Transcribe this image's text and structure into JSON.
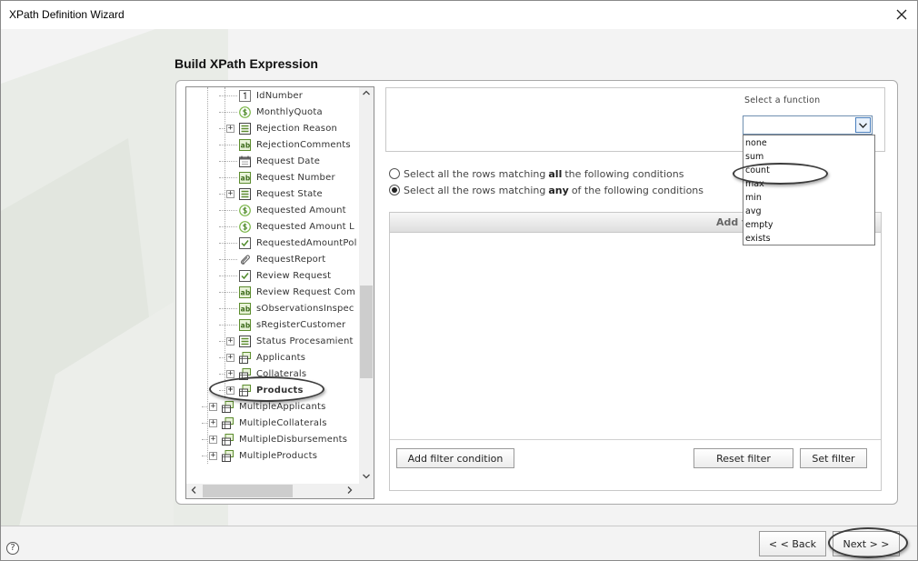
{
  "window": {
    "title": "XPath Definition Wizard"
  },
  "heading": "Build XPath Expression",
  "tree": {
    "items": [
      {
        "label": "IdNumber",
        "icon": "number-field-icon",
        "expander": false,
        "level": 2,
        "bold": false
      },
      {
        "label": "MonthlyQuota",
        "icon": "currency-field-icon",
        "expander": false,
        "level": 2,
        "bold": false
      },
      {
        "label": "Rejection Reason",
        "icon": "list-field-icon",
        "expander": true,
        "level": 2,
        "bold": false
      },
      {
        "label": "RejectionComments",
        "icon": "text-field-icon",
        "expander": false,
        "level": 2,
        "bold": false
      },
      {
        "label": "Request Date",
        "icon": "date-field-icon",
        "expander": false,
        "level": 2,
        "bold": false
      },
      {
        "label": "Request Number",
        "icon": "text-field-icon",
        "expander": false,
        "level": 2,
        "bold": false
      },
      {
        "label": "Request State",
        "icon": "list-field-icon",
        "expander": true,
        "level": 2,
        "bold": false
      },
      {
        "label": "Requested Amount",
        "icon": "currency-field-icon",
        "expander": false,
        "level": 2,
        "bold": false
      },
      {
        "label": "Requested Amount L",
        "icon": "currency-field-icon",
        "expander": false,
        "level": 2,
        "bold": false
      },
      {
        "label": "RequestedAmountPol",
        "icon": "boolean-field-icon",
        "expander": false,
        "level": 2,
        "bold": false
      },
      {
        "label": "RequestReport",
        "icon": "attachment-icon",
        "expander": false,
        "level": 2,
        "bold": false
      },
      {
        "label": "Review Request",
        "icon": "boolean-field-icon",
        "expander": false,
        "level": 2,
        "bold": false
      },
      {
        "label": "Review Request Com",
        "icon": "text-field-icon",
        "expander": false,
        "level": 2,
        "bold": false
      },
      {
        "label": "sObservationsInspec",
        "icon": "text-field-icon",
        "expander": false,
        "level": 2,
        "bold": false
      },
      {
        "label": "sRegisterCustomer",
        "icon": "text-field-icon",
        "expander": false,
        "level": 2,
        "bold": false
      },
      {
        "label": "Status Procesamient",
        "icon": "list-field-icon",
        "expander": true,
        "level": 2,
        "bold": false
      },
      {
        "label": "Applicants",
        "icon": "collection-icon",
        "expander": true,
        "level": 2,
        "bold": false
      },
      {
        "label": "Collaterals",
        "icon": "collection-icon",
        "expander": true,
        "level": 2,
        "bold": false
      },
      {
        "label": "Products",
        "icon": "collection-icon",
        "expander": true,
        "level": 2,
        "bold": true
      },
      {
        "label": "MultipleApplicants",
        "icon": "collection-icon",
        "expander": true,
        "level": 1,
        "bold": false
      },
      {
        "label": "MultipleCollaterals",
        "icon": "collection-icon",
        "expander": true,
        "level": 1,
        "bold": false
      },
      {
        "label": "MultipleDisbursements",
        "icon": "collection-icon",
        "expander": true,
        "level": 1,
        "bold": false
      },
      {
        "label": "MultipleProducts",
        "icon": "collection-icon",
        "expander": true,
        "level": 1,
        "bold": false
      }
    ]
  },
  "function_select": {
    "label": "Select a function",
    "value": "",
    "options": [
      "none",
      "sum",
      "count",
      "max",
      "min",
      "avg",
      "empty",
      "exists"
    ]
  },
  "conditions": {
    "all": {
      "before": "Select all the rows matching",
      "keyword": "all",
      "after": "the following conditions",
      "selected": false
    },
    "any": {
      "before": "Select all the rows matching",
      "keyword": "any",
      "after": "of the following conditions",
      "selected": true
    }
  },
  "filter": {
    "header": "Add f",
    "add_condition": "Add filter condition",
    "reset": "Reset  filter",
    "set": "Set  filter"
  },
  "nav": {
    "back": "< < Back",
    "next": "Next > >"
  },
  "help": "?",
  "colors": {
    "accent_border": "#4a7fbd",
    "currency_icon": "#7ab648",
    "text_icon": "#5c8c2e"
  }
}
